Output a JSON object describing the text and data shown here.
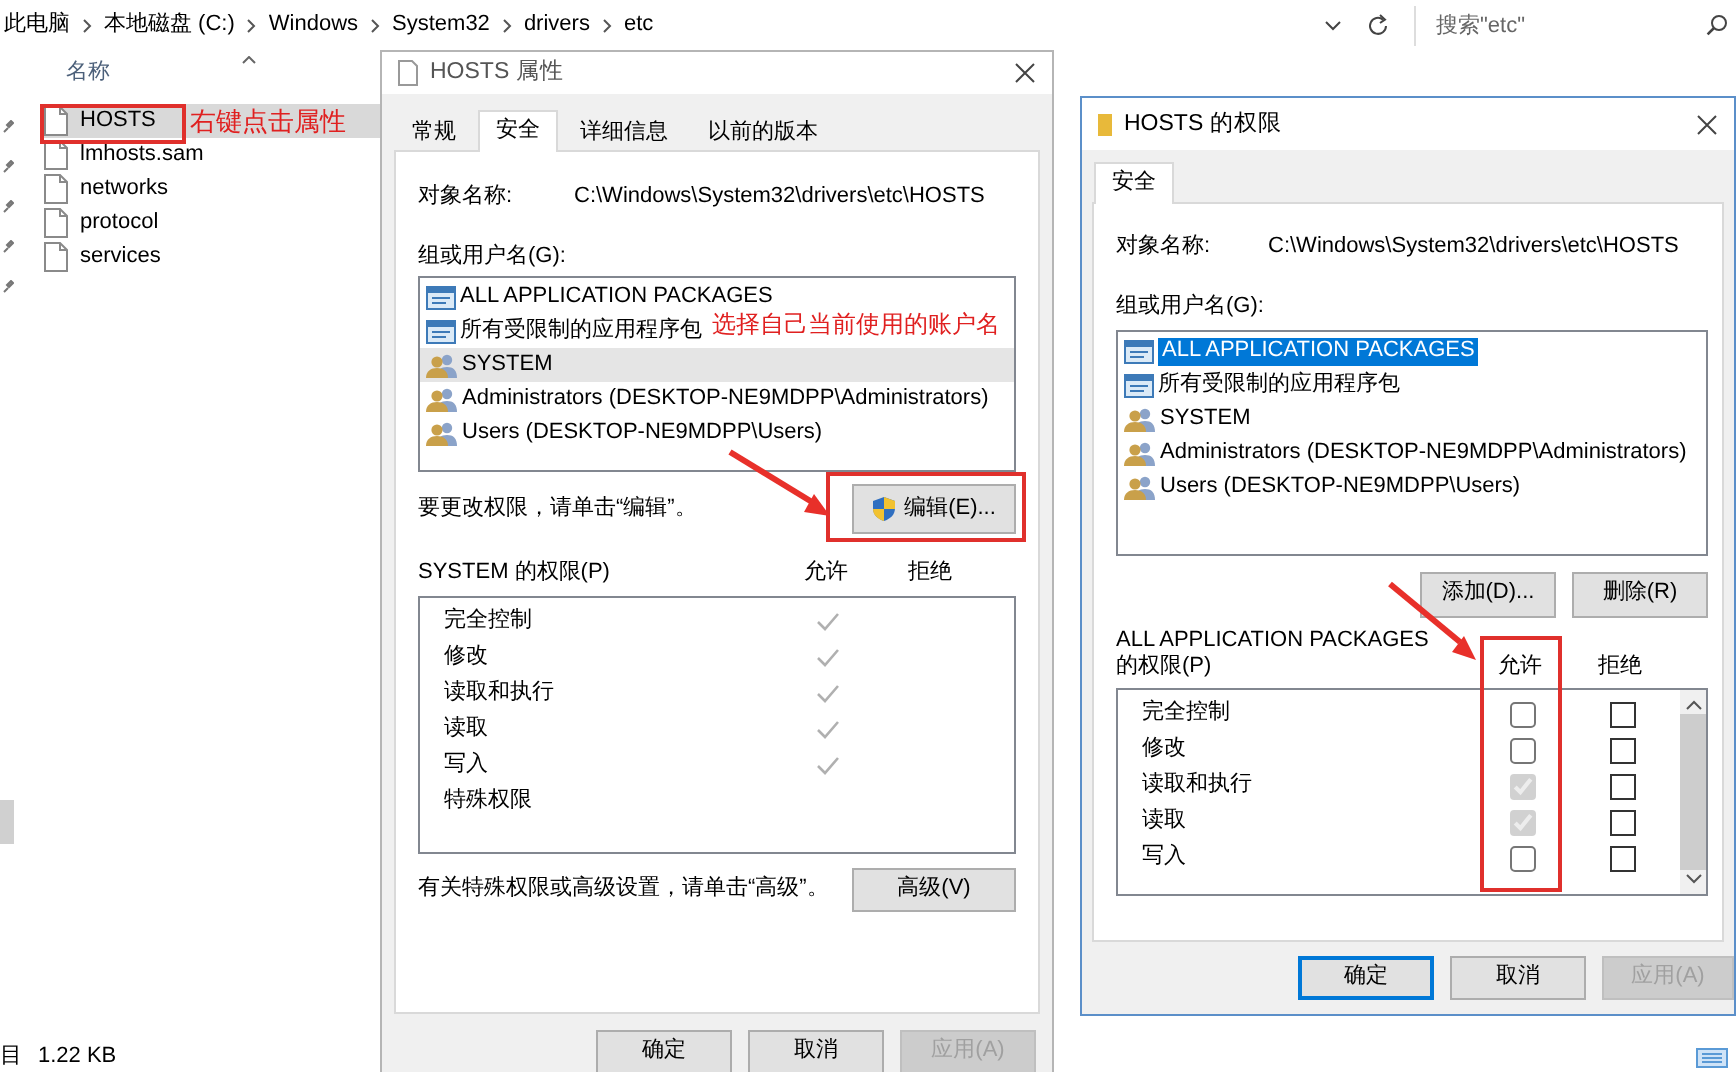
{
  "address_bar": {
    "breadcrumbs": [
      "此电脑",
      "本地磁盘 (C:)",
      "Windows",
      "System32",
      "drivers",
      "etc"
    ],
    "search": {
      "placeholder": "搜索\"etc\""
    }
  },
  "explorer": {
    "column_header": "名称",
    "files": [
      {
        "name": "HOSTS",
        "selected": true
      },
      {
        "name": "lmhosts.sam",
        "selected": false
      },
      {
        "name": "networks",
        "selected": false
      },
      {
        "name": "protocol",
        "selected": false
      },
      {
        "name": "services",
        "selected": false
      }
    ],
    "annotation": "右键点击属性",
    "status": [
      "目",
      "1.22 KB"
    ]
  },
  "properties_dialog": {
    "title": "HOSTS 属性",
    "tabs": [
      {
        "label": "常规",
        "selected": false
      },
      {
        "label": "安全",
        "selected": true
      },
      {
        "label": "详细信息",
        "selected": false
      },
      {
        "label": "以前的版本",
        "selected": false
      }
    ],
    "object_label": "对象名称:",
    "object_path": "C:\\Windows\\System32\\drivers\\etc\\HOSTS",
    "groups_label": "组或用户名(G):",
    "groups": [
      {
        "name": "ALL APPLICATION PACKAGES",
        "kind": "package",
        "selected": false
      },
      {
        "name": "所有受限制的应用程序包",
        "kind": "package",
        "selected": false
      },
      {
        "name": "SYSTEM",
        "kind": "user",
        "selected": true
      },
      {
        "name": "Administrators (DESKTOP-NE9MDPP\\Administrators)",
        "kind": "user",
        "selected": false
      },
      {
        "name": "Users (DESKTOP-NE9MDPP\\Users)",
        "kind": "user",
        "selected": false
      }
    ],
    "annotation": "选择自己当前使用的账户名",
    "edit_hint": "要更改权限，请单击“编辑”。",
    "edit_button": "编辑(E)...",
    "permissions_label": "SYSTEM 的权限(P)",
    "allow_header": "允许",
    "deny_header": "拒绝",
    "permissions": [
      {
        "name": "完全控制",
        "allow": true
      },
      {
        "name": "修改",
        "allow": true
      },
      {
        "name": "读取和执行",
        "allow": true
      },
      {
        "name": "读取",
        "allow": true
      },
      {
        "name": "写入",
        "allow": true
      },
      {
        "name": "特殊权限",
        "allow": false
      }
    ],
    "advanced_hint": "有关特殊权限或高级设置，请单击“高级”。",
    "advanced_button": "高级(V)",
    "buttons": [
      {
        "label": "确定",
        "disabled": false
      },
      {
        "label": "取消",
        "disabled": false
      },
      {
        "label": "应用(A)",
        "disabled": true
      }
    ]
  },
  "permissions_dialog": {
    "title": "HOSTS 的权限",
    "tabs": [
      {
        "label": "安全",
        "selected": true
      }
    ],
    "object_label": "对象名称:",
    "object_path": "C:\\Windows\\System32\\drivers\\etc\\HOSTS",
    "groups_label": "组或用户名(G):",
    "groups": [
      {
        "name": "ALL APPLICATION PACKAGES",
        "kind": "package",
        "selected": true
      },
      {
        "name": "所有受限制的应用程序包",
        "kind": "package",
        "selected": false
      },
      {
        "name": "SYSTEM",
        "kind": "user",
        "selected": false
      },
      {
        "name": "Administrators (DESKTOP-NE9MDPP\\Administrators)",
        "kind": "user",
        "selected": false
      },
      {
        "name": "Users (DESKTOP-NE9MDPP\\Users)",
        "kind": "user",
        "selected": false
      }
    ],
    "add_button": "添加(D)...",
    "remove_button": "删除(R)",
    "permissions_for": "ALL APPLICATION PACKAGES",
    "permissions_label": "的权限(P)",
    "allow_header": "允许",
    "deny_header": "拒绝",
    "permissions": [
      {
        "name": "完全控制",
        "allow": {
          "checked": false,
          "disabled": false
        },
        "deny": false
      },
      {
        "name": "修改",
        "allow": {
          "checked": false,
          "disabled": false
        },
        "deny": false
      },
      {
        "name": "读取和执行",
        "allow": {
          "checked": true,
          "disabled": true
        },
        "deny": false
      },
      {
        "name": "读取",
        "allow": {
          "checked": true,
          "disabled": true
        },
        "deny": false
      },
      {
        "name": "写入",
        "allow": {
          "checked": false,
          "disabled": false
        },
        "deny": false
      }
    ],
    "buttons": [
      {
        "label": "确定",
        "focused": true,
        "disabled": false
      },
      {
        "label": "取消",
        "focused": false,
        "disabled": false
      },
      {
        "label": "应用(A)",
        "focused": false,
        "disabled": true
      }
    ]
  }
}
